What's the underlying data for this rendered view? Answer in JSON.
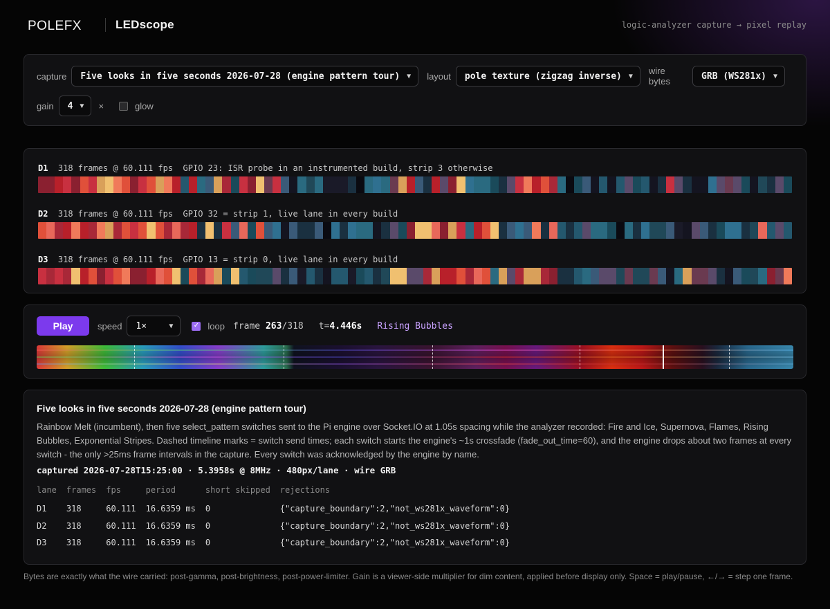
{
  "header": {
    "logo_text": "POLEFX",
    "app_name": "LEDscope",
    "tagline": "logic-analyzer capture → pixel replay"
  },
  "controls": {
    "capture_label": "capture",
    "capture_value": "Five looks in five seconds 2026-07-28 (engine pattern tour)",
    "layout_label": "layout",
    "layout_value": "pole texture (zigzag inverse)",
    "wire_label": "wire bytes",
    "wire_value": "GRB (WS281x)",
    "gain_label": "gain",
    "gain_value": "4",
    "gain_suffix": "×",
    "glow_label": "glow",
    "glow_checked": false
  },
  "lanes": [
    {
      "name": "D1",
      "desc": "318 frames @ 60.111 fps  GPIO 23: ISR probe in an instrumented build, strip 3 otherwise"
    },
    {
      "name": "D2",
      "desc": "318 frames @ 60.111 fps  GPIO 32 = strip 1, live lane in every build"
    },
    {
      "name": "D3",
      "desc": "318 frames @ 60.111 fps  GPIO 13 = strip 0, live lane in every build"
    }
  ],
  "player": {
    "play_label": "Play",
    "speed_label": "speed",
    "speed_value": "1×",
    "loop_label": "loop",
    "loop_checked": true,
    "frame_label": "frame",
    "frame_current": "263",
    "frame_total": "/318",
    "time_label": "t=",
    "time_value": "4.446s",
    "pattern_name": "Rising Bubbles",
    "playhead_fraction": 0.827,
    "switch_marks_fraction": [
      0.129,
      0.326,
      0.523,
      0.718,
      0.915
    ]
  },
  "info": {
    "title": "Five looks in five seconds 2026-07-28 (engine pattern tour)",
    "description": "Rainbow Melt (incumbent), then five select_pattern switches sent to the Pi engine over Socket.IO at 1.05s spacing while the analyzer recorded: Fire and Ice, Supernova, Flames, Rising Bubbles, Exponential Stripes. Dashed timeline marks = switch send times; each switch starts the engine's ~1s crossfade (fade_out_time=60), and the engine drops about two frames at every switch - the only >25ms frame intervals in the capture. Every switch was acknowledged by the engine by name.",
    "meta": "captured 2026-07-28T15:25:00 · 5.3958s @ 8MHz · 480px/lane · wire GRB",
    "table": {
      "headers": [
        "lane",
        "frames",
        "fps",
        "period",
        "short skipped",
        "rejections"
      ],
      "rows": [
        [
          "D1",
          "318",
          "60.111",
          "16.6359 ms",
          "0",
          "{\"capture_boundary\":2,\"not_ws281x_waveform\":0}"
        ],
        [
          "D2",
          "318",
          "60.111",
          "16.6359 ms",
          "0",
          "{\"capture_boundary\":2,\"not_ws281x_waveform\":0}"
        ],
        [
          "D3",
          "318",
          "60.111",
          "16.6359 ms",
          "0",
          "{\"capture_boundary\":2,\"not_ws281x_waveform\":0}"
        ]
      ]
    }
  },
  "footnote": "Bytes are exactly what the wire carried: post-gamma, post-brightness, post-power-limiter. Gain is a viewer-side multiplier for dim content, applied before display only. Space = play/pause, ←/→ = step one frame.",
  "colors": {
    "accent": "#7c3aed",
    "pattern_text": "#c9a2ff",
    "card_bg": "#111113",
    "page_bg": "#050505"
  }
}
